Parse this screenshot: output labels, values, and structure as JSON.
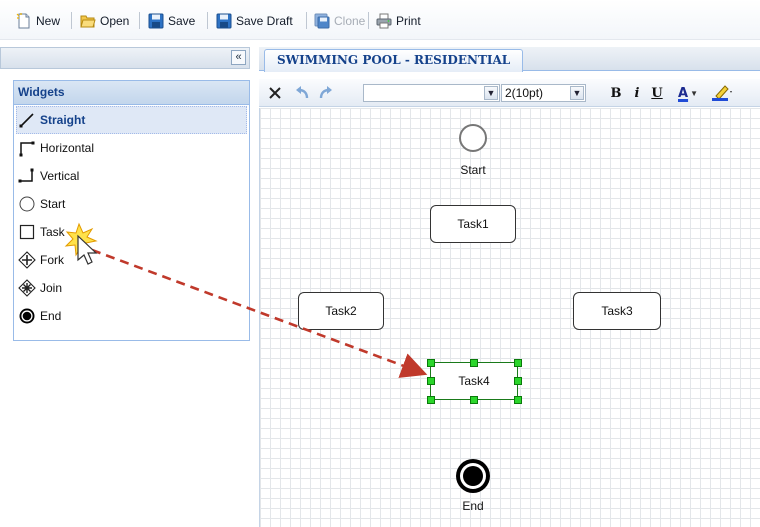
{
  "toolbar": {
    "new": "New",
    "open": "Open",
    "save": "Save",
    "save_draft": "Save Draft",
    "clone": "Clone",
    "print": "Print"
  },
  "widgets": {
    "title": "Widgets",
    "items": [
      {
        "label": "Straight",
        "icon": "straight-line-icon"
      },
      {
        "label": "Horizontal",
        "icon": "horizontal-connector-icon"
      },
      {
        "label": "Vertical",
        "icon": "vertical-connector-icon"
      },
      {
        "label": "Start",
        "icon": "start-circle-icon"
      },
      {
        "label": "Task",
        "icon": "task-square-icon"
      },
      {
        "label": "Fork",
        "icon": "fork-icon"
      },
      {
        "label": "Join",
        "icon": "join-icon"
      },
      {
        "label": "End",
        "icon": "end-circle-icon"
      }
    ]
  },
  "editor": {
    "tab_label": "SWIMMING POOL - RESIDENTIAL",
    "font_select_value": "",
    "size_select_value": "2(10pt)",
    "bold_label": "B",
    "italic_label": "i",
    "underline_label": "U",
    "font_color_label": "A"
  },
  "diagram": {
    "start_label": "Start",
    "task1_label": "Task1",
    "task2_label": "Task2",
    "task3_label": "Task3",
    "task4_label": "Task4",
    "end_label": "End"
  },
  "colors": {
    "accent_blue": "#15428b",
    "selection_green": "#2bd62b",
    "drag_arrow_red": "#c0392b"
  }
}
